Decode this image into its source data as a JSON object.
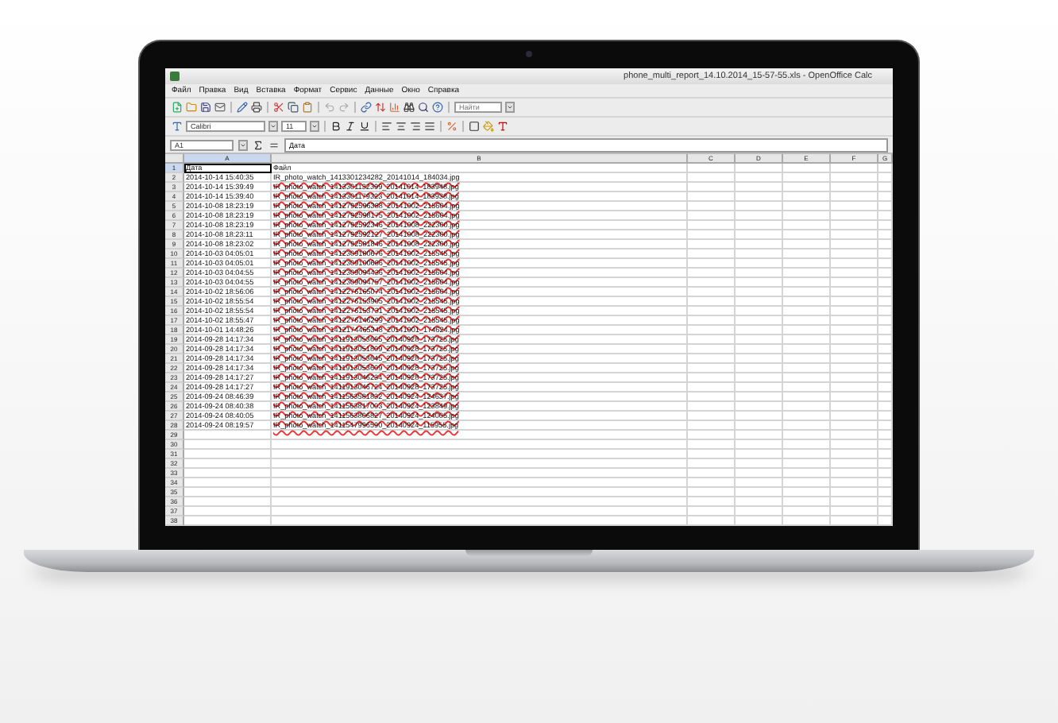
{
  "window": {
    "title": "phone_multi_report_14.10.2014_15-57-55.xls - OpenOffice Calc"
  },
  "menu": [
    "Файл",
    "Правка",
    "Вид",
    "Вставка",
    "Формат",
    "Сервис",
    "Данные",
    "Окно",
    "Справка"
  ],
  "formatting": {
    "font": "Calibri",
    "size": "11"
  },
  "find": {
    "placeholder": "Найти"
  },
  "formula_bar": {
    "cell": "A1",
    "content": "Дата"
  },
  "columns": [
    {
      "label": "A",
      "selected": true
    },
    {
      "label": "B",
      "selected": false
    },
    {
      "label": "C",
      "selected": false
    },
    {
      "label": "D",
      "selected": false
    },
    {
      "label": "E",
      "selected": false
    },
    {
      "label": "F",
      "selected": false
    },
    {
      "label": "G",
      "selected": false
    }
  ],
  "rows": [
    {
      "number": "1",
      "a": "Дата",
      "b": "Файл",
      "selected": true
    },
    {
      "number": "2",
      "a": "2014-10-14 15:40:35",
      "b": "IR_photo_watch_1413301234282_20141014_184034.jpg",
      "selected": false
    },
    {
      "number": "3",
      "a": "2014-10-14 15:39:49",
      "b": "IR_photo_watch_1413301132399_20141014_183948.jpg",
      "selected": false
    },
    {
      "number": "4",
      "a": "2014-10-14 15:39:40",
      "b": "IR_photo_watch_1413301179323_20141014_183938.jpg",
      "selected": false
    },
    {
      "number": "5",
      "a": "2014-10-08 18:23:19",
      "b": "IR_photo_watch_1412792596388_20141002_215604.jpg",
      "selected": false
    },
    {
      "number": "6",
      "a": "2014-10-08 18:23:19",
      "b": "IR_photo_watch_1412792598175_20141002_215604.jpg",
      "selected": false
    },
    {
      "number": "7",
      "a": "2014-10-08 18:23:19",
      "b": "IR_photo_watch_1412792592346_20141008_222300.jpg",
      "selected": false
    },
    {
      "number": "8",
      "a": "2014-10-08 18:23:11",
      "b": "IR_photo_watch_1412792592127_20141008_222300.jpg",
      "selected": false
    },
    {
      "number": "9",
      "a": "2014-10-08 18:23:02",
      "b": "IR_photo_watch_1412792581846_20141008_222300.jpg",
      "selected": false
    },
    {
      "number": "10",
      "a": "2014-10-03 04:05:01",
      "b": "IR_photo_watch_1412309180676_20141002_215545.jpg",
      "selected": false
    },
    {
      "number": "11",
      "a": "2014-10-03 04:05:01",
      "b": "IR_photo_watch_1412309100686_20141002_215545.jpg",
      "selected": false
    },
    {
      "number": "12",
      "a": "2014-10-03 04:04:55",
      "b": "IR_photo_watch_1412309094436_20141002_215604.jpg",
      "selected": false
    },
    {
      "number": "13",
      "a": "2014-10-03 04:04:55",
      "b": "IR_photo_watch_1412309094757_20141002_215604.jpg",
      "selected": false
    },
    {
      "number": "14",
      "a": "2014-10-02 18:56:06",
      "b": "IR_photo_watch_1412276165074_20141002_215604.jpg",
      "selected": false
    },
    {
      "number": "15",
      "a": "2014-10-02 18:55:54",
      "b": "IR_photo_watch_1412276153905_20141002_215545.jpg",
      "selected": false
    },
    {
      "number": "16",
      "a": "2014-10-02 18:55:54",
      "b": "IR_photo_watch_1412276153731_20141002_215545.jpg",
      "selected": false
    },
    {
      "number": "17",
      "a": "2014-10-02 18:55:47",
      "b": "IR_photo_watch_1412276146299_20141002_215545.jpg",
      "selected": false
    },
    {
      "number": "18",
      "a": "2014-10-01 14:48:26",
      "b": "IR_photo_watch_1412174465348_20141001_174624.jpg",
      "selected": false
    },
    {
      "number": "19",
      "a": "2014-09-28 14:17:34",
      "b": "IR_photo_watch_1411913053665_20140928_173725.jpg",
      "selected": false
    },
    {
      "number": "20",
      "a": "2014-09-28 14:17:34",
      "b": "IR_photo_watch_1411913051809_20140928_173725.jpg",
      "selected": false
    },
    {
      "number": "21",
      "a": "2014-09-28 14:17:34",
      "b": "IR_photo_watch_1411913053645_20140928_173725.jpg",
      "selected": false
    },
    {
      "number": "22",
      "a": "2014-09-28 14:17:34",
      "b": "IR_photo_watch_1411913053609_20140928_173725.jpg",
      "selected": false
    },
    {
      "number": "23",
      "a": "2014-09-28 14:17:27",
      "b": "IR_photo_watch_1411913046234_20140928_173725.jpg",
      "selected": false
    },
    {
      "number": "24",
      "a": "2014-09-28 14:17:27",
      "b": "IR_photo_watch_1411913046724_20140928_173725.jpg",
      "selected": false
    },
    {
      "number": "25",
      "a": "2014-09-24 08:46:39",
      "b": "IR_photo_watch_1411563581832_20140924_124637.jpg",
      "selected": false
    },
    {
      "number": "26",
      "a": "2014-09-24 08:40:38",
      "b": "IR_photo_watch_1411563817003_20140924_123849.jpg",
      "selected": false
    },
    {
      "number": "27",
      "a": "2014-09-24 08:40:05",
      "b": "IR_photo_watch_1411563806827_20140924_124005.jpg",
      "selected": false
    },
    {
      "number": "28",
      "a": "2014-09-24 08:19:57",
      "b": "IR_photo_watch_1411547996590_20140924_115955.jpg",
      "selected": false
    },
    {
      "number": "29",
      "selected": false
    },
    {
      "number": "30",
      "selected": false
    },
    {
      "number": "31",
      "selected": false
    },
    {
      "number": "32",
      "selected": false
    },
    {
      "number": "33",
      "selected": false
    },
    {
      "number": "34",
      "selected": false
    },
    {
      "number": "35",
      "selected": false
    },
    {
      "number": "36",
      "selected": false
    },
    {
      "number": "37",
      "selected": false
    },
    {
      "number": "38",
      "selected": false
    }
  ]
}
